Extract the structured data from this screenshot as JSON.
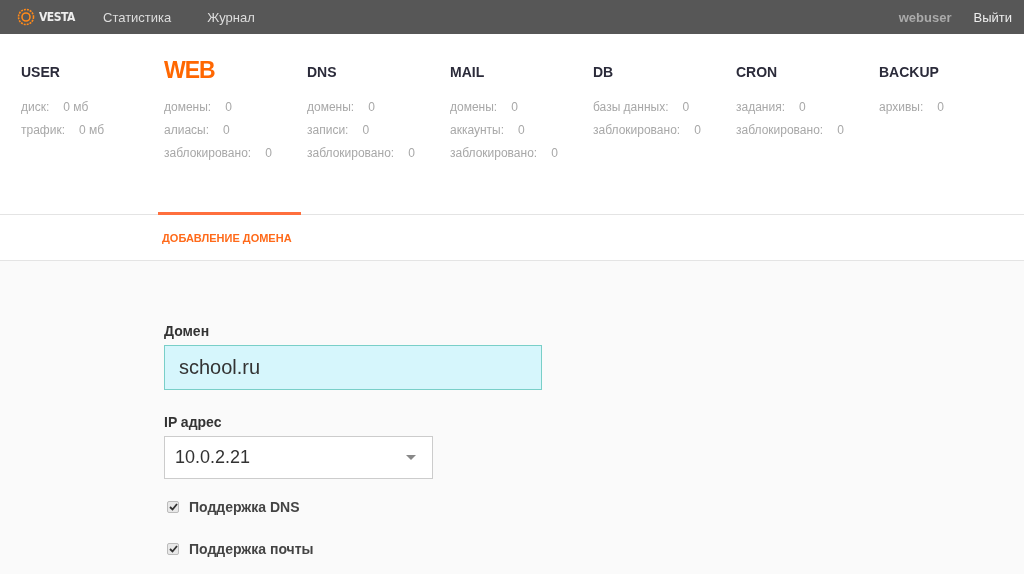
{
  "top_bar": {
    "logo": "VESTA",
    "links": [
      "Статистика",
      "Журнал"
    ],
    "user": "webuser",
    "logout": "Выйти"
  },
  "categories": [
    {
      "title": "USER",
      "selected": false,
      "stats": [
        {
          "label": "диск:",
          "value": "0 мб"
        },
        {
          "label": "трафик:",
          "value": "0 мб"
        }
      ]
    },
    {
      "title": "WEB",
      "selected": true,
      "stats": [
        {
          "label": "домены:",
          "value": "0"
        },
        {
          "label": "алиасы:",
          "value": "0"
        },
        {
          "label": "заблокировано:",
          "value": "0"
        }
      ]
    },
    {
      "title": "DNS",
      "selected": false,
      "stats": [
        {
          "label": "домены:",
          "value": "0"
        },
        {
          "label": "записи:",
          "value": "0"
        },
        {
          "label": "заблокировано:",
          "value": "0"
        }
      ]
    },
    {
      "title": "MAIL",
      "selected": false,
      "stats": [
        {
          "label": "домены:",
          "value": "0"
        },
        {
          "label": "аккаунты:",
          "value": "0"
        },
        {
          "label": "заблокировано:",
          "value": "0"
        }
      ]
    },
    {
      "title": "DB",
      "selected": false,
      "stats": [
        {
          "label": "базы данных:",
          "value": "0"
        },
        {
          "label": "заблокировано:",
          "value": "0"
        }
      ]
    },
    {
      "title": "CRON",
      "selected": false,
      "stats": [
        {
          "label": "задания:",
          "value": "0"
        },
        {
          "label": "заблокировано:",
          "value": "0"
        }
      ]
    },
    {
      "title": "BACKUP",
      "selected": false,
      "stats": [
        {
          "label": "архивы:",
          "value": "0"
        }
      ]
    }
  ],
  "subnav": {
    "title": "ДОБАВЛЕНИЕ ДОМЕНА"
  },
  "form": {
    "domain": {
      "label": "Домен",
      "value": "school.ru"
    },
    "ip": {
      "label": "IP адрес",
      "value": "10.0.2.21"
    },
    "options": [
      {
        "label": "Поддержка DNS",
        "checked": true
      },
      {
        "label": "Поддержка почты",
        "checked": true
      }
    ]
  }
}
